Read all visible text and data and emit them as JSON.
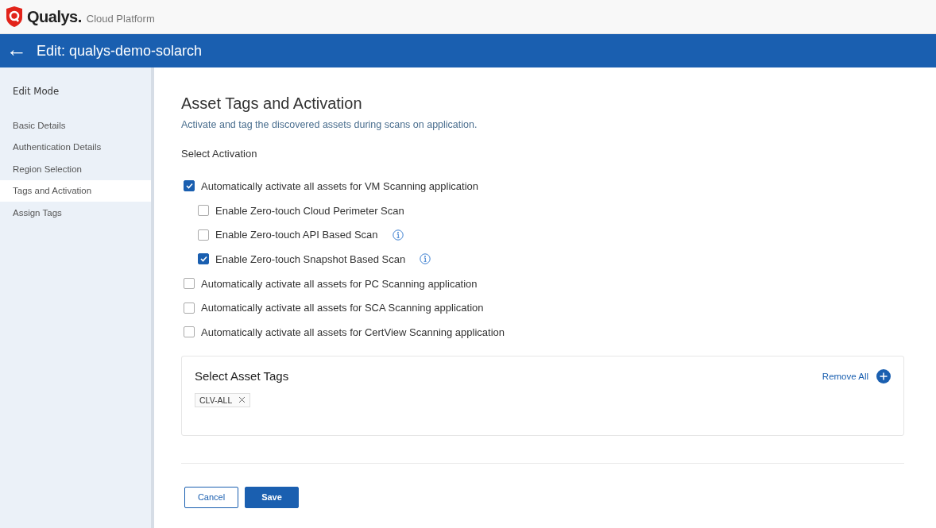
{
  "brand": {
    "name": "Qualys.",
    "product": "Cloud Platform"
  },
  "header": {
    "back": "←",
    "title": "Edit: qualys-demo-solarch"
  },
  "sidebar": {
    "heading": "Edit Mode",
    "items": [
      {
        "label": "Basic Details",
        "selected": false
      },
      {
        "label": "Authentication Details",
        "selected": false
      },
      {
        "label": "Region Selection",
        "selected": false
      },
      {
        "label": "Tags and Activation",
        "selected": true
      },
      {
        "label": "Assign Tags",
        "selected": false
      }
    ]
  },
  "page": {
    "title": "Asset Tags and Activation",
    "subtitle": "Activate and tag the discovered assets during scans on application.",
    "section": "Select Activation"
  },
  "options": [
    {
      "label": "Automatically activate all assets for VM Scanning application",
      "checked": true,
      "info": false,
      "children": [
        {
          "label": "Enable Zero-touch Cloud Perimeter Scan",
          "checked": false,
          "info": false
        },
        {
          "label": "Enable Zero-touch API Based Scan",
          "checked": false,
          "info": true
        },
        {
          "label": "Enable Zero-touch Snapshot Based Scan",
          "checked": true,
          "info": true
        }
      ]
    },
    {
      "label": "Automatically activate all assets for PC Scanning application",
      "checked": false,
      "info": false
    },
    {
      "label": "Automatically activate all assets for SCA Scanning application",
      "checked": false,
      "info": false
    },
    {
      "label": "Automatically activate all assets for CertView Scanning application",
      "checked": false,
      "info": false
    }
  ],
  "tags_card": {
    "title": "Select Asset Tags",
    "remove_all": "Remove All",
    "tags": [
      "CLV-ALL"
    ]
  },
  "buttons": {
    "cancel": "Cancel",
    "save": "Save"
  }
}
